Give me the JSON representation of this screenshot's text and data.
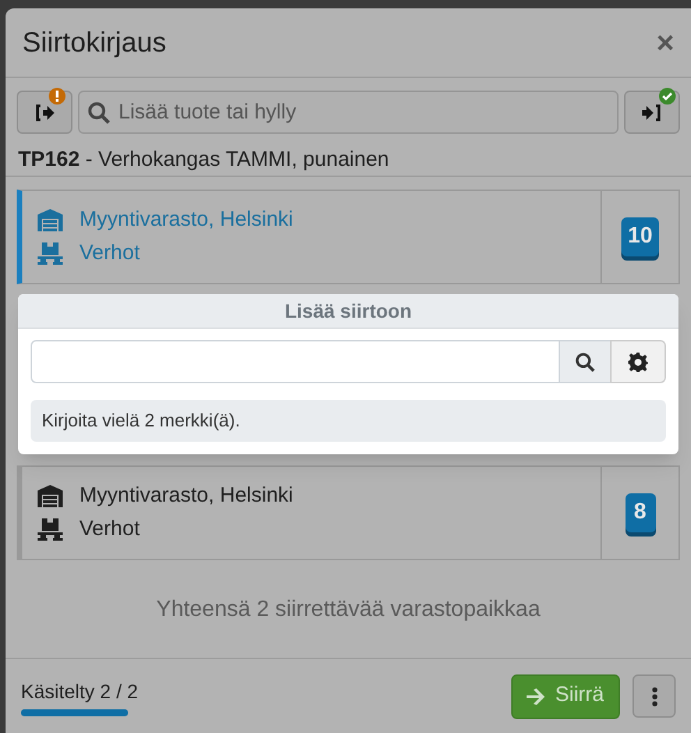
{
  "window": {
    "title": "Siirtokirjaus",
    "close": "×"
  },
  "toolbar": {
    "export_warning": true,
    "search": {
      "placeholder": "Lisää tuote tai hylly"
    },
    "import_done": true
  },
  "product": {
    "code": "TP162",
    "name": " - Verhokangas TAMMI, punainen"
  },
  "locations": [
    {
      "warehouse": "Myyntivarasto, Helsinki",
      "shelf": "Verhot",
      "quantity": "10",
      "selected": true
    },
    {
      "warehouse": "Myyntivarasto, Helsinki",
      "shelf": "Verhot",
      "quantity": "8",
      "selected": false
    }
  ],
  "total": "Yhteensä 2 siirrettävää varastopaikkaa",
  "popup": {
    "title": "Lisää siirtoon",
    "message": "Kirjoita vielä 2 merkki(ä)."
  },
  "footer": {
    "progress": {
      "label": "Käsitelty 2 / 2",
      "level": 1
    },
    "transfer_button": "Siirrä"
  }
}
